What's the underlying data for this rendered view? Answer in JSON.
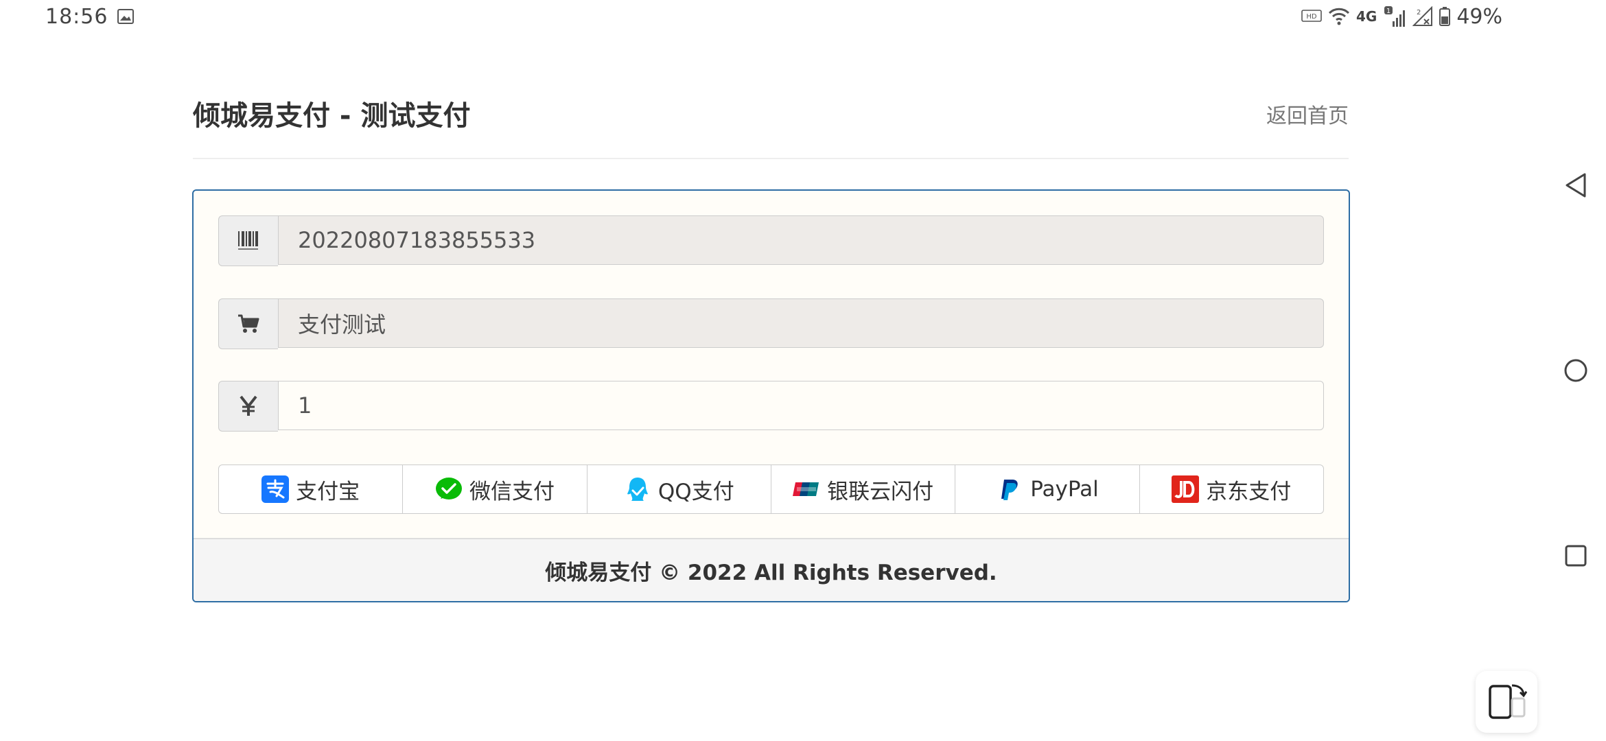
{
  "status_bar": {
    "time": "18:56",
    "network": "4G",
    "battery": "49%"
  },
  "header": {
    "title": "倾城易支付 - 测试支付",
    "home_link": "返回首页"
  },
  "form": {
    "order_no": "20220807183855533",
    "product_name": "支付测试",
    "amount": "1"
  },
  "payment_methods": [
    {
      "label": "支付宝",
      "icon": "alipay-icon",
      "color": "#1677ff"
    },
    {
      "label": "微信支付",
      "icon": "wechat-pay-icon",
      "color": "#09bb07"
    },
    {
      "label": "QQ支付",
      "icon": "qq-pay-icon",
      "color": "#12b7f5"
    },
    {
      "label": "银联云闪付",
      "icon": "unionpay-icon",
      "color": "#e21836"
    },
    {
      "label": "PayPal",
      "icon": "paypal-icon",
      "color": "#003087"
    },
    {
      "label": "京东支付",
      "icon": "jd-pay-icon",
      "color": "#e1251b"
    }
  ],
  "footer": {
    "text": "倾城易支付 © 2022 All Rights Reserved."
  },
  "colors": {
    "panel_border": "#2e6da4",
    "panel_background": "#fffdf8",
    "addon_background": "#eeeeee",
    "readonly_field": "#eeebe8"
  }
}
